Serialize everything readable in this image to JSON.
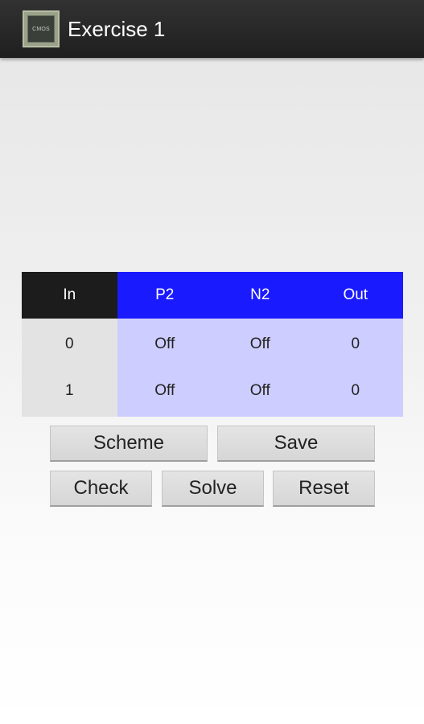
{
  "action_bar": {
    "title": "Exercise 1",
    "icon": {
      "name": "cmos-chip-icon",
      "label": "CMOS"
    }
  },
  "truth_table": {
    "headers": [
      "In",
      "P2",
      "N2",
      "Out"
    ],
    "rows": [
      [
        "0",
        "Off",
        "Off",
        "0"
      ],
      [
        "1",
        "Off",
        "Off",
        "0"
      ]
    ],
    "colors": {
      "input_header": "#1c1c1c",
      "output_header": "#1a1aff",
      "input_cells": "#e3e3e3",
      "output_cells": "#cdcdff"
    }
  },
  "buttons": {
    "scheme": "Scheme",
    "save": "Save",
    "check": "Check",
    "solve": "Solve",
    "reset": "Reset"
  }
}
